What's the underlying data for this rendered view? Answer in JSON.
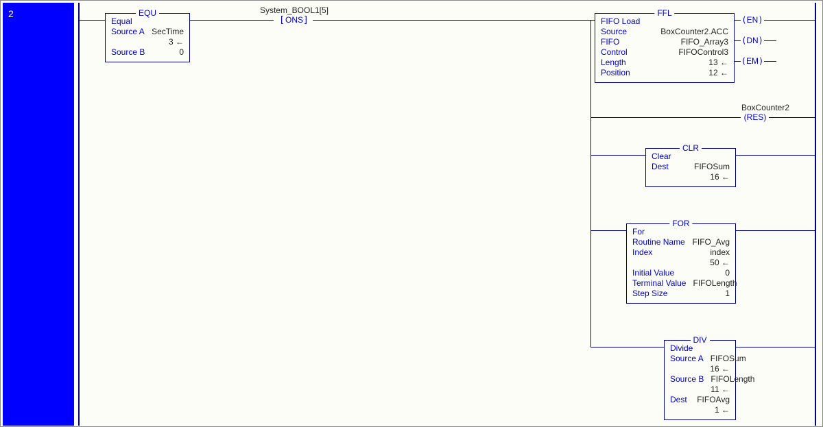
{
  "rung_number": "2",
  "equ": {
    "mnemonic": "EQU",
    "title": "Equal",
    "rows": [
      {
        "label": "Source A",
        "value": "SecTime",
        "sub": "3"
      },
      {
        "label": "Source B",
        "value": "0"
      }
    ]
  },
  "ons": {
    "tag": "System_BOOL1[5]",
    "text": "ONS"
  },
  "ffl": {
    "mnemonic": "FFL",
    "title": "FIFO Load",
    "rows": [
      {
        "label": "Source",
        "value": "BoxCounter2.ACC"
      },
      {
        "label": "FIFO",
        "value": "FIFO_Array3"
      },
      {
        "label": "Control",
        "value": "FIFOControl3"
      },
      {
        "label": "Length",
        "value": "13",
        "arrow": true
      },
      {
        "label": "Position",
        "value": "12",
        "arrow": true
      }
    ],
    "pins": [
      "EN",
      "DN",
      "EM"
    ]
  },
  "res": {
    "tag": "BoxCounter2",
    "text": "RES"
  },
  "clr": {
    "mnemonic": "CLR",
    "title": "Clear",
    "rows": [
      {
        "label": "Dest",
        "value": "FIFOSum",
        "sub": "16"
      }
    ]
  },
  "forblk": {
    "mnemonic": "FOR",
    "title": "For",
    "rows": [
      {
        "label": "Routine Name",
        "value": "FIFO_Avg"
      },
      {
        "label": "Index",
        "value": "index",
        "sub": "50"
      },
      {
        "label": "Initial Value",
        "value": "0"
      },
      {
        "label": "Terminal Value",
        "value": "FIFOLength"
      },
      {
        "label": "Step Size",
        "value": "1"
      }
    ]
  },
  "divblk": {
    "mnemonic": "DIV",
    "title": "Divide",
    "rows": [
      {
        "label": "Source A",
        "value": "FIFOSum",
        "sub": "16"
      },
      {
        "label": "Source B",
        "value": "FIFOLength",
        "sub": "11"
      },
      {
        "label": "Dest",
        "value": "FIFOAvg",
        "sub": "1"
      }
    ]
  }
}
